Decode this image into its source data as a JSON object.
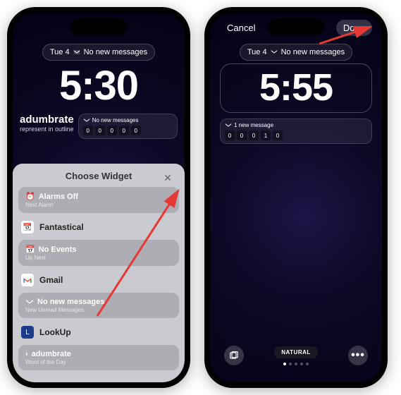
{
  "phone1": {
    "date": "Tue 4",
    "msg_status": "No new messages",
    "clock": "5:30",
    "word": {
      "title": "adumbrate",
      "sub": "represent in outline"
    },
    "widget": {
      "label": "No new messages",
      "counters": [
        "0",
        "0",
        "0",
        "0",
        "0"
      ]
    },
    "sheet": {
      "title": "Choose Widget",
      "close": "✕",
      "alarm": {
        "title": "Alarms Off",
        "sub": "Next Alarm",
        "icon": "⏰"
      },
      "app_fantastical": "Fantastical",
      "events": {
        "title": "No Events",
        "sub": "Up Next",
        "icon": "📅"
      },
      "app_gmail": "Gmail",
      "messages": {
        "title": "No new messages",
        "sub": "New Unread Messages"
      },
      "app_lookup": "LookUp",
      "word_card": {
        "title": "adumbrate",
        "sub": "Word of the Day",
        "chev": "›"
      }
    }
  },
  "phone2": {
    "cancel": "Cancel",
    "done": "Done",
    "date": "Tue 4",
    "msg_status": "No new messages",
    "clock": "5:55",
    "widget": {
      "label": "1 new message",
      "counters": [
        "0",
        "0",
        "0",
        "1",
        "0"
      ]
    },
    "style": "NATURAL"
  }
}
